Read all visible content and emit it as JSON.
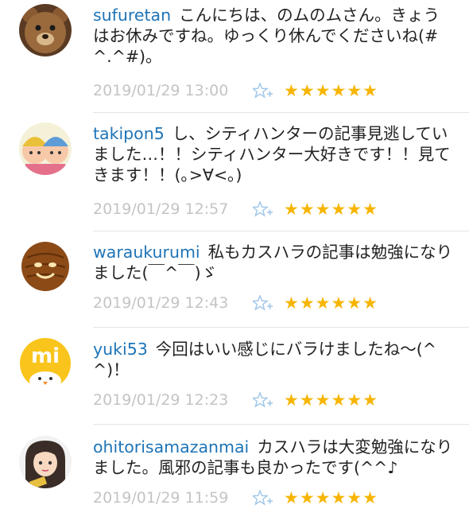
{
  "comments": [
    {
      "user": "sufuretan",
      "text": "こんにちは、のムのムさん。きょうはお休みですね。ゆっくり休んでくださいね(#^.^#)。",
      "time": "2019/01/29 13:00",
      "stars": "★★★★★★",
      "avatar_icon": "teddy-bear-icon"
    },
    {
      "user": "takipon5",
      "text": "し、シティハンターの記事見逃していました…！！シティハンター大好きです！！見てきます！！(｡>∀<｡)",
      "time": "2019/01/29 12:57",
      "stars": "★★★★★★",
      "avatar_icon": "cartoon-characters-icon"
    },
    {
      "user": "waraukurumi",
      "text": "私もカスハラの記事は勉強になりました(￣^￣)ゞ",
      "time": "2019/01/29 12:43",
      "stars": "★★★★★★",
      "avatar_icon": "walnut-face-icon"
    },
    {
      "user": "yuki53",
      "text": "今回はいい感じにバラけましたね～(^^)！",
      "time": "2019/01/29 12:23",
      "stars": "★★★★★★",
      "avatar_icon": "mi-chick-icon"
    },
    {
      "user": "ohitorisamazanmai",
      "text": "カスハラは大変勉強になりました。風邪の記事も良かったです(^^♪",
      "time": "2019/01/29 11:59",
      "stars": "★★★★★★",
      "avatar_icon": "anime-girl-icon"
    }
  ],
  "colors": {
    "username": "#1e74b7",
    "star": "#f7b500",
    "timestamp": "#c4c4c4",
    "add_star": "#9ec6e8"
  }
}
